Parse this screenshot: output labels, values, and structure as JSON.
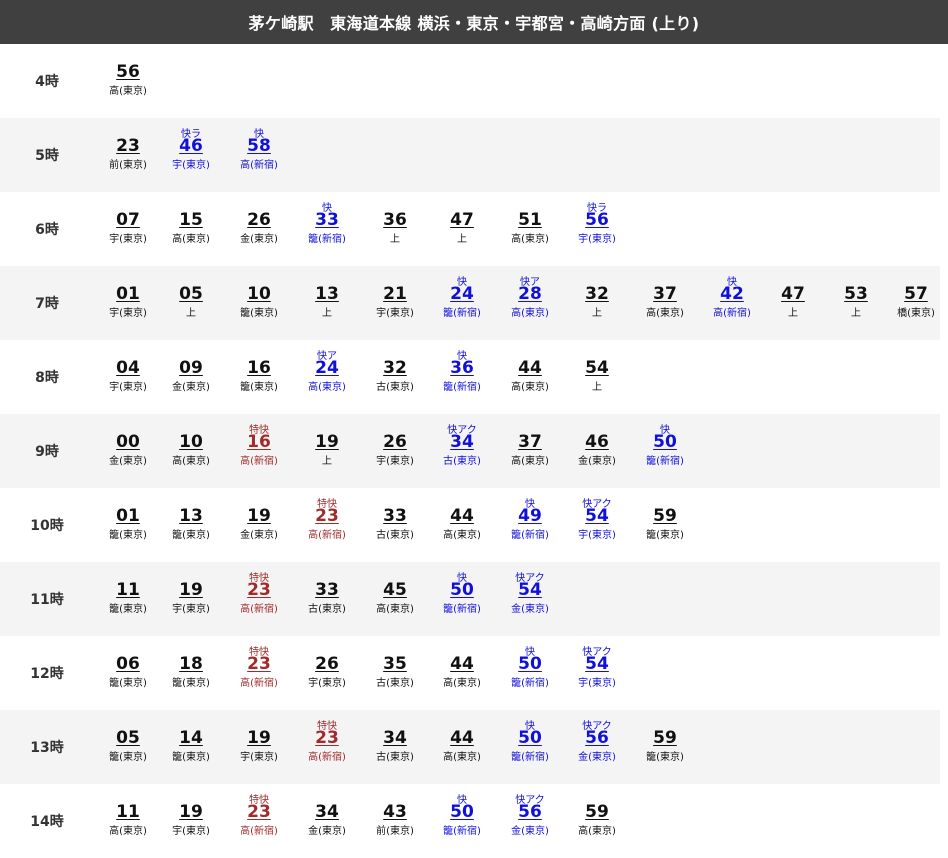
{
  "header": {
    "title": "茅ケ崎駅　東海道本線 横浜・東京・宇都宮・高崎方面 (上り)"
  },
  "colors": {
    "local": "#111111",
    "rapid": "#1010d8",
    "special_rapid": "#a02b2b",
    "header_bg": "#404040"
  },
  "rows": [
    {
      "hour": "4時",
      "trains": [
        {
          "min": "56",
          "dest": "高(東京)",
          "type": "",
          "kind": "local"
        }
      ]
    },
    {
      "hour": "5時",
      "trains": [
        {
          "min": "23",
          "dest": "前(東京)",
          "type": "",
          "kind": "local"
        },
        {
          "min": "46",
          "dest": "宇(東京)",
          "type": "快ラ",
          "kind": "rapid"
        },
        {
          "min": "58",
          "dest": "高(新宿)",
          "type": "快",
          "kind": "rapid"
        }
      ]
    },
    {
      "hour": "6時",
      "trains": [
        {
          "min": "07",
          "dest": "宇(東京)",
          "type": "",
          "kind": "local"
        },
        {
          "min": "15",
          "dest": "高(東京)",
          "type": "",
          "kind": "local"
        },
        {
          "min": "26",
          "dest": "金(東京)",
          "type": "",
          "kind": "local"
        },
        {
          "min": "33",
          "dest": "籠(新宿)",
          "type": "快",
          "kind": "rapid"
        },
        {
          "min": "36",
          "dest": "上",
          "type": "",
          "kind": "local"
        },
        {
          "min": "47",
          "dest": "上",
          "type": "",
          "kind": "local"
        },
        {
          "min": "51",
          "dest": "高(東京)",
          "type": "",
          "kind": "local"
        },
        {
          "min": "56",
          "dest": "宇(東京)",
          "type": "快ラ",
          "kind": "rapid"
        }
      ]
    },
    {
      "hour": "7時",
      "trains": [
        {
          "min": "01",
          "dest": "宇(東京)",
          "type": "",
          "kind": "local"
        },
        {
          "min": "05",
          "dest": "上",
          "type": "",
          "kind": "local"
        },
        {
          "min": "10",
          "dest": "籠(東京)",
          "type": "",
          "kind": "local"
        },
        {
          "min": "13",
          "dest": "上",
          "type": "",
          "kind": "local"
        },
        {
          "min": "21",
          "dest": "宇(東京)",
          "type": "",
          "kind": "local"
        },
        {
          "min": "24",
          "dest": "籠(新宿)",
          "type": "快",
          "kind": "rapid"
        },
        {
          "min": "28",
          "dest": "高(東京)",
          "type": "快ア",
          "kind": "rapid"
        },
        {
          "min": "32",
          "dest": "上",
          "type": "",
          "kind": "local"
        },
        {
          "min": "37",
          "dest": "高(東京)",
          "type": "",
          "kind": "local"
        },
        {
          "min": "42",
          "dest": "高(新宿)",
          "type": "快",
          "kind": "rapid"
        },
        {
          "min": "47",
          "dest": "上",
          "type": "",
          "kind": "local"
        },
        {
          "min": "53",
          "dest": "上",
          "type": "",
          "kind": "local"
        },
        {
          "min": "57",
          "dest": "橋(東京)",
          "type": "",
          "kind": "local"
        }
      ]
    },
    {
      "hour": "8時",
      "trains": [
        {
          "min": "04",
          "dest": "宇(東京)",
          "type": "",
          "kind": "local"
        },
        {
          "min": "09",
          "dest": "金(東京)",
          "type": "",
          "kind": "local"
        },
        {
          "min": "16",
          "dest": "籠(東京)",
          "type": "",
          "kind": "local"
        },
        {
          "min": "24",
          "dest": "高(東京)",
          "type": "快ア",
          "kind": "rapid"
        },
        {
          "min": "32",
          "dest": "古(東京)",
          "type": "",
          "kind": "local"
        },
        {
          "min": "36",
          "dest": "籠(新宿)",
          "type": "快",
          "kind": "rapid"
        },
        {
          "min": "44",
          "dest": "高(東京)",
          "type": "",
          "kind": "local"
        },
        {
          "min": "54",
          "dest": "上",
          "type": "",
          "kind": "local"
        }
      ]
    },
    {
      "hour": "9時",
      "trains": [
        {
          "min": "00",
          "dest": "金(東京)",
          "type": "",
          "kind": "local"
        },
        {
          "min": "10",
          "dest": "高(東京)",
          "type": "",
          "kind": "local"
        },
        {
          "min": "16",
          "dest": "高(新宿)",
          "type": "特快",
          "kind": "special"
        },
        {
          "min": "19",
          "dest": "上",
          "type": "",
          "kind": "local"
        },
        {
          "min": "26",
          "dest": "宇(東京)",
          "type": "",
          "kind": "local"
        },
        {
          "min": "34",
          "dest": "古(東京)",
          "type": "快アク",
          "kind": "rapid"
        },
        {
          "min": "37",
          "dest": "高(東京)",
          "type": "",
          "kind": "local"
        },
        {
          "min": "46",
          "dest": "金(東京)",
          "type": "",
          "kind": "local"
        },
        {
          "min": "50",
          "dest": "籠(新宿)",
          "type": "快",
          "kind": "rapid"
        }
      ]
    },
    {
      "hour": "10時",
      "trains": [
        {
          "min": "01",
          "dest": "籠(東京)",
          "type": "",
          "kind": "local"
        },
        {
          "min": "13",
          "dest": "籠(東京)",
          "type": "",
          "kind": "local"
        },
        {
          "min": "19",
          "dest": "金(東京)",
          "type": "",
          "kind": "local"
        },
        {
          "min": "23",
          "dest": "高(新宿)",
          "type": "特快",
          "kind": "special"
        },
        {
          "min": "33",
          "dest": "古(東京)",
          "type": "",
          "kind": "local"
        },
        {
          "min": "44",
          "dest": "高(東京)",
          "type": "",
          "kind": "local"
        },
        {
          "min": "49",
          "dest": "籠(新宿)",
          "type": "快",
          "kind": "rapid"
        },
        {
          "min": "54",
          "dest": "宇(東京)",
          "type": "快アク",
          "kind": "rapid"
        },
        {
          "min": "59",
          "dest": "籠(東京)",
          "type": "",
          "kind": "local"
        }
      ]
    },
    {
      "hour": "11時",
      "trains": [
        {
          "min": "11",
          "dest": "籠(東京)",
          "type": "",
          "kind": "local"
        },
        {
          "min": "19",
          "dest": "宇(東京)",
          "type": "",
          "kind": "local"
        },
        {
          "min": "23",
          "dest": "高(新宿)",
          "type": "特快",
          "kind": "special"
        },
        {
          "min": "33",
          "dest": "古(東京)",
          "type": "",
          "kind": "local"
        },
        {
          "min": "45",
          "dest": "高(東京)",
          "type": "",
          "kind": "local"
        },
        {
          "min": "50",
          "dest": "籠(新宿)",
          "type": "快",
          "kind": "rapid"
        },
        {
          "min": "54",
          "dest": "金(東京)",
          "type": "快アク",
          "kind": "rapid"
        }
      ]
    },
    {
      "hour": "12時",
      "trains": [
        {
          "min": "06",
          "dest": "籠(東京)",
          "type": "",
          "kind": "local"
        },
        {
          "min": "18",
          "dest": "籠(東京)",
          "type": "",
          "kind": "local"
        },
        {
          "min": "23",
          "dest": "高(新宿)",
          "type": "特快",
          "kind": "special"
        },
        {
          "min": "26",
          "dest": "宇(東京)",
          "type": "",
          "kind": "local"
        },
        {
          "min": "35",
          "dest": "古(東京)",
          "type": "",
          "kind": "local"
        },
        {
          "min": "44",
          "dest": "高(東京)",
          "type": "",
          "kind": "local"
        },
        {
          "min": "50",
          "dest": "籠(新宿)",
          "type": "快",
          "kind": "rapid"
        },
        {
          "min": "54",
          "dest": "宇(東京)",
          "type": "快アク",
          "kind": "rapid"
        }
      ]
    },
    {
      "hour": "13時",
      "trains": [
        {
          "min": "05",
          "dest": "籠(東京)",
          "type": "",
          "kind": "local"
        },
        {
          "min": "14",
          "dest": "籠(東京)",
          "type": "",
          "kind": "local"
        },
        {
          "min": "19",
          "dest": "宇(東京)",
          "type": "",
          "kind": "local"
        },
        {
          "min": "23",
          "dest": "高(新宿)",
          "type": "特快",
          "kind": "special"
        },
        {
          "min": "34",
          "dest": "古(東京)",
          "type": "",
          "kind": "local"
        },
        {
          "min": "44",
          "dest": "高(東京)",
          "type": "",
          "kind": "local"
        },
        {
          "min": "50",
          "dest": "籠(新宿)",
          "type": "快",
          "kind": "rapid"
        },
        {
          "min": "56",
          "dest": "金(東京)",
          "type": "快アク",
          "kind": "rapid"
        },
        {
          "min": "59",
          "dest": "籠(東京)",
          "type": "",
          "kind": "local"
        }
      ]
    },
    {
      "hour": "14時",
      "trains": [
        {
          "min": "11",
          "dest": "高(東京)",
          "type": "",
          "kind": "local"
        },
        {
          "min": "19",
          "dest": "宇(東京)",
          "type": "",
          "kind": "local"
        },
        {
          "min": "23",
          "dest": "高(新宿)",
          "type": "特快",
          "kind": "special"
        },
        {
          "min": "34",
          "dest": "金(東京)",
          "type": "",
          "kind": "local"
        },
        {
          "min": "43",
          "dest": "前(東京)",
          "type": "",
          "kind": "local"
        },
        {
          "min": "50",
          "dest": "籠(新宿)",
          "type": "快",
          "kind": "rapid"
        },
        {
          "min": "56",
          "dest": "金(東京)",
          "type": "快アク",
          "kind": "rapid"
        },
        {
          "min": "59",
          "dest": "高(東京)",
          "type": "",
          "kind": "local"
        }
      ]
    }
  ]
}
